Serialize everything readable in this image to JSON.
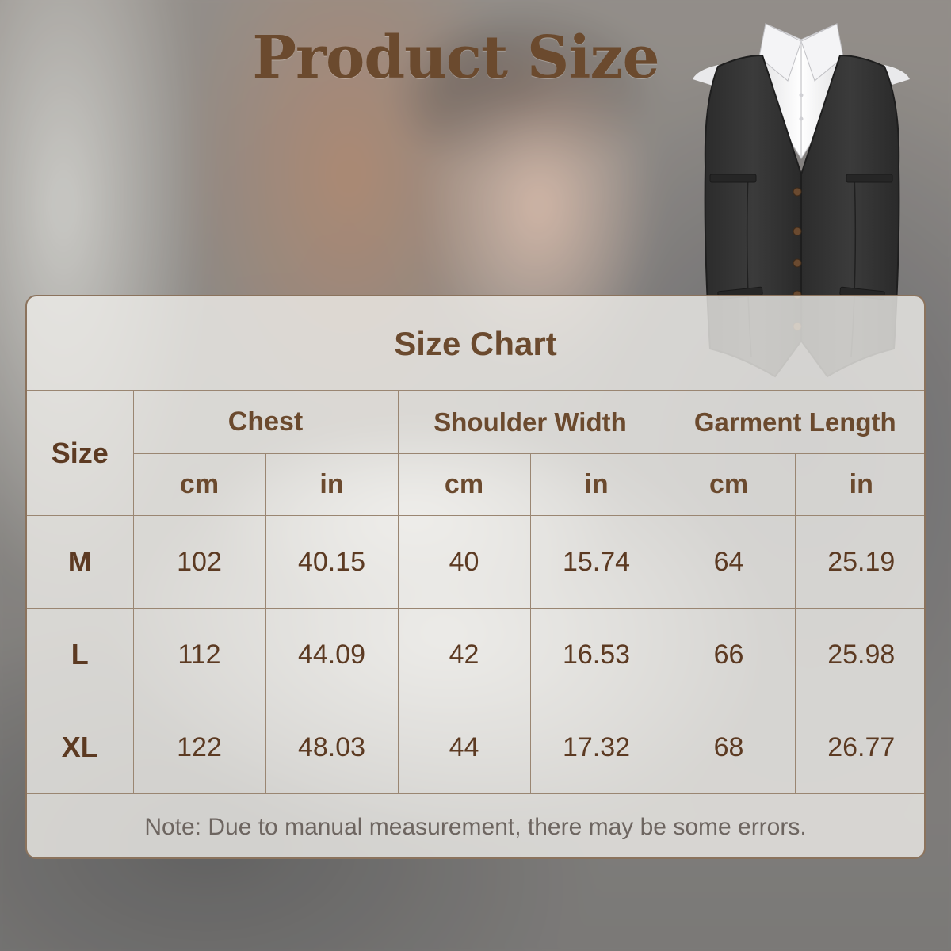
{
  "page": {
    "title": "Product Size"
  },
  "size_chart": {
    "title": "Size Chart",
    "size_header": "Size",
    "groups": [
      "Chest",
      "Shoulder Width",
      "Garment Length"
    ],
    "units": [
      "cm",
      "in",
      "cm",
      "in",
      "cm",
      "in"
    ],
    "rows": [
      {
        "size": "M",
        "values": [
          "102",
          "40.15",
          "40",
          "15.74",
          "64",
          "25.19"
        ]
      },
      {
        "size": "L",
        "values": [
          "112",
          "44.09",
          "42",
          "16.53",
          "66",
          "25.98"
        ]
      },
      {
        "size": "XL",
        "values": [
          "122",
          "48.03",
          "44",
          "17.32",
          "68",
          "26.77"
        ]
      }
    ],
    "note": "Note: Due to manual measurement, there may be some errors."
  },
  "colors": {
    "title_brown": "#6b4a2e",
    "value_brown": "#5c3a22",
    "border": "#8b735d"
  },
  "icons": {
    "product": "vest-illustration"
  }
}
